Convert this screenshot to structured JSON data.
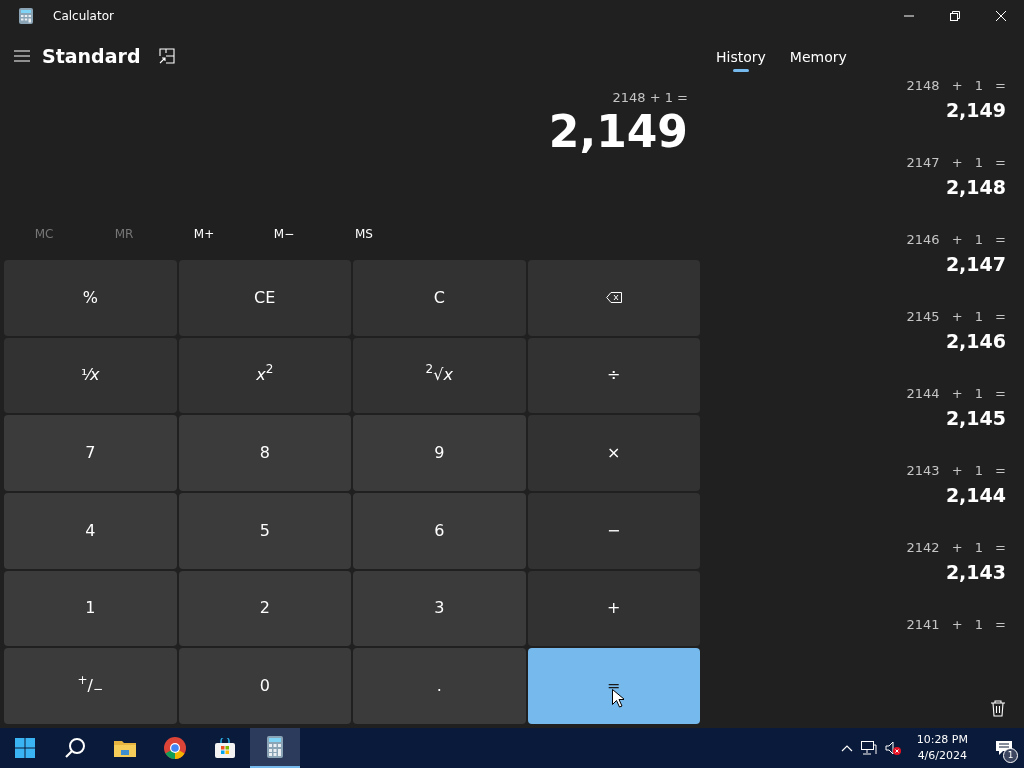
{
  "window": {
    "title": "Calculator"
  },
  "mode": "Standard",
  "display": {
    "expression": "2148 + 1 =",
    "value": "2,149"
  },
  "memory_buttons": [
    {
      "label": "MC",
      "disabled": true
    },
    {
      "label": "MR",
      "disabled": true
    },
    {
      "label": "M+",
      "disabled": false
    },
    {
      "label": "M−",
      "disabled": false
    },
    {
      "label": "MS",
      "disabled": false
    }
  ],
  "keys": [
    {
      "label": "%",
      "kind": "op"
    },
    {
      "label": "CE",
      "kind": "op"
    },
    {
      "label": "C",
      "kind": "op"
    },
    {
      "kind": "backspace"
    },
    {
      "label": "¹⁄*x*",
      "kind": "op"
    },
    {
      "label": "*x*$^{2}$",
      "kind": "op"
    },
    {
      "label": "$^{2}$√*x*",
      "kind": "op"
    },
    {
      "label": "÷",
      "kind": "op"
    },
    {
      "label": "7",
      "kind": "digit"
    },
    {
      "label": "8",
      "kind": "digit"
    },
    {
      "label": "9",
      "kind": "digit"
    },
    {
      "label": "×",
      "kind": "op"
    },
    {
      "label": "4",
      "kind": "digit"
    },
    {
      "label": "5",
      "kind": "digit"
    },
    {
      "label": "6",
      "kind": "digit"
    },
    {
      "label": "−",
      "kind": "op"
    },
    {
      "label": "1",
      "kind": "digit"
    },
    {
      "label": "2",
      "kind": "digit"
    },
    {
      "label": "3",
      "kind": "digit"
    },
    {
      "label": "+",
      "kind": "op"
    },
    {
      "label": "$^{+}$/$_{−}$",
      "kind": "digit"
    },
    {
      "label": "0",
      "kind": "digit"
    },
    {
      "label": ".",
      "kind": "digit"
    },
    {
      "label": "=",
      "kind": "equals"
    }
  ],
  "panel_tabs": [
    {
      "label": "History",
      "selected": true
    },
    {
      "label": "Memory",
      "selected": false
    }
  ],
  "history": [
    {
      "expression": "2148 + 1 =",
      "result": "2,149"
    },
    {
      "expression": "2147 + 1 =",
      "result": "2,148"
    },
    {
      "expression": "2146 + 1 =",
      "result": "2,147"
    },
    {
      "expression": "2145 + 1 =",
      "result": "2,146"
    },
    {
      "expression": "2144 + 1 =",
      "result": "2,145"
    },
    {
      "expression": "2143 + 1 =",
      "result": "2,144"
    },
    {
      "expression": "2142 + 1 =",
      "result": "2,143"
    },
    {
      "expression": "2141 + 1 ="
    }
  ],
  "taskbar": {
    "time": "10:28 PM",
    "date": "4/6/2024",
    "notifications": "1"
  }
}
